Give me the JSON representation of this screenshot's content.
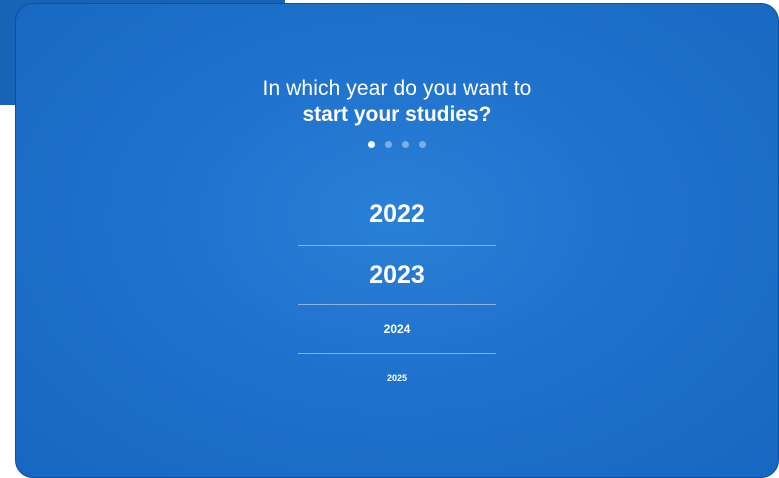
{
  "question": {
    "line1": "In which year do you want to",
    "line2": "start your studies?"
  },
  "progress": {
    "total_steps": 4,
    "current_step": 1
  },
  "options": [
    {
      "label": "2022"
    },
    {
      "label": "2023"
    },
    {
      "label": "2024"
    },
    {
      "label": "2025"
    }
  ],
  "colors": {
    "card_background": "#1f72cc",
    "back_panel": "#1763b8",
    "text": "#ffffff"
  }
}
